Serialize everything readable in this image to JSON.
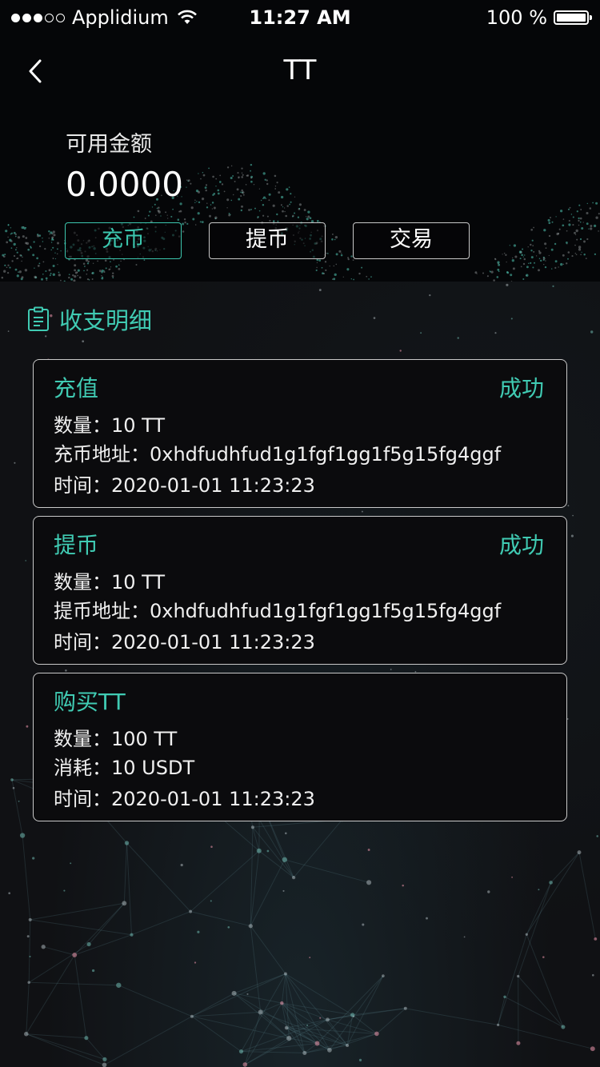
{
  "status_bar": {
    "carrier": "Applidium",
    "time": "11:27 AM",
    "battery": "100 %"
  },
  "nav": {
    "title": "TT",
    "back_icon": "chevron-left-icon"
  },
  "balance": {
    "label": "可用金额",
    "value": "0.0000"
  },
  "actions": [
    {
      "label": "充币",
      "active": true
    },
    {
      "label": "提币",
      "active": false
    },
    {
      "label": "交易",
      "active": false
    }
  ],
  "section": {
    "icon": "clipboard-list-icon",
    "title": "收支明细"
  },
  "records": [
    {
      "type": "充值",
      "status": "成功",
      "quantity": "数量：10 TT",
      "detail": "充币地址：0xhdfudhfud1g1fgf1gg1f5g15fg4ggf",
      "time": "时间：2020-01-01 11:23:23"
    },
    {
      "type": "提币",
      "status": "成功",
      "quantity": "数量：10 TT",
      "detail": "提币地址：0xhdfudhfud1g1fgf1gg1f5g15fg4ggf",
      "time": "时间：2020-01-01 11:23:23"
    },
    {
      "type": "购买TT",
      "status": "",
      "quantity": "数量：100 TT",
      "detail": "消耗：10 USDT",
      "time": "时间：2020-01-01 11:23:23"
    }
  ],
  "colors": {
    "accent": "#40cbb3",
    "background": "#101114",
    "card_border": "#c9c9c9"
  }
}
